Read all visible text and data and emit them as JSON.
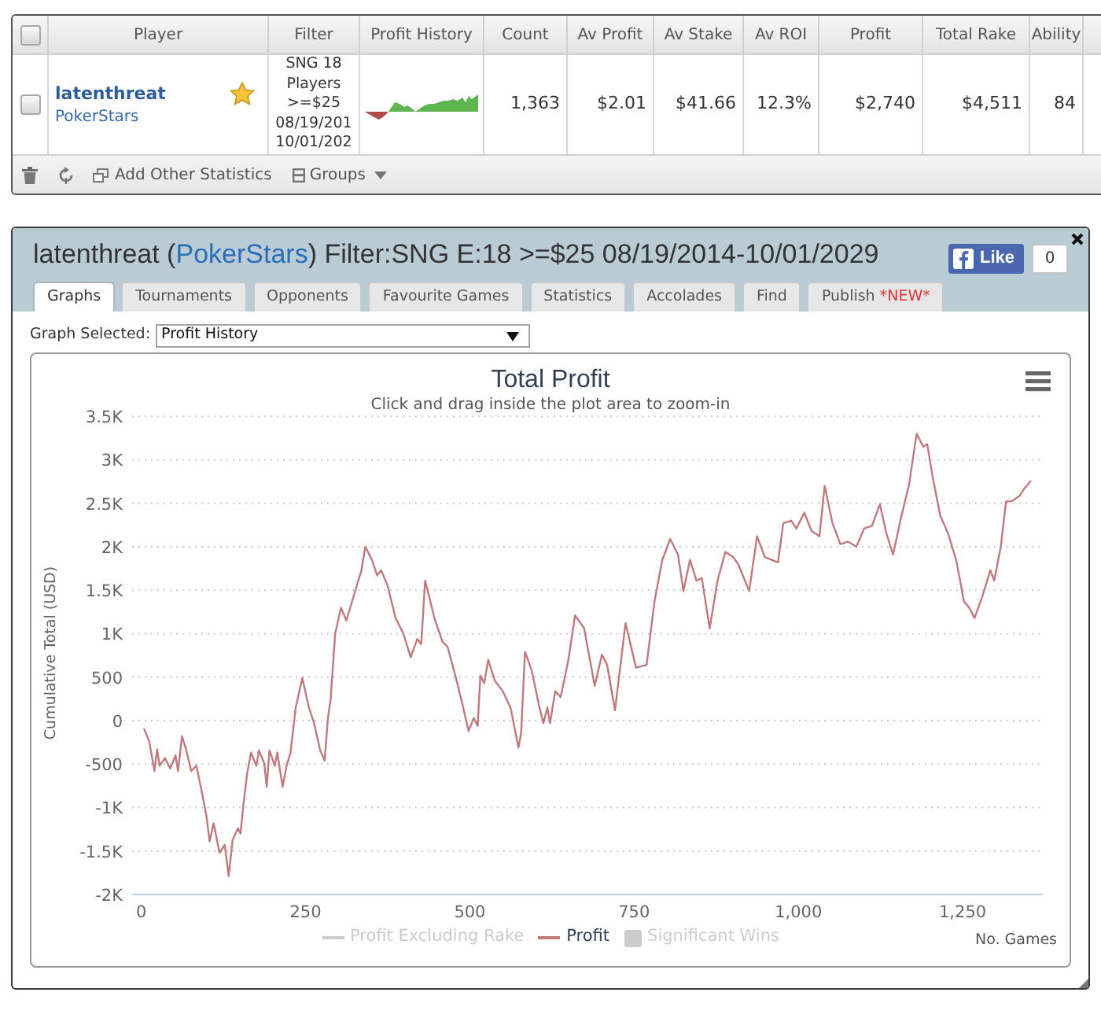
{
  "stats_table": {
    "select_all": {
      "checked": false
    },
    "columns": [
      "Player",
      "Filter",
      "Profit History",
      "Count",
      "Av Profit",
      "Av Stake",
      "Av ROI",
      "Profit",
      "Total Rake",
      "Ability"
    ],
    "rows": [
      {
        "checked": false,
        "player": "latenthreat",
        "site": "PokerStars",
        "favourite": true,
        "filter": [
          "SNG 18",
          "Players",
          ">=$25",
          "08/19/201",
          "10/01/202"
        ],
        "count": "1,363",
        "av_profit": "$2.01",
        "av_stake": "$41.66",
        "av_roi": "12.3%",
        "profit": "$2,740",
        "total_rake": "$4,511",
        "ability": "84"
      }
    ],
    "toolbar": [
      {
        "kind": "delete"
      },
      {
        "kind": "refresh"
      },
      {
        "kind": "add",
        "label": "Add Other Statistics"
      },
      {
        "kind": "groups",
        "label": "Groups"
      }
    ]
  },
  "profile_panel": {
    "title": [
      {
        "kind": "plain",
        "text": "latenthreat ("
      },
      {
        "kind": "link",
        "text": "PokerStars"
      },
      {
        "kind": "plain",
        "text": ") Filter:SNG E:18 >=$25 08/19/2014-10/01/2029"
      }
    ],
    "like_button": {
      "label": "Like",
      "count": "0"
    },
    "tabs": [
      {
        "label": "Graphs",
        "selected": true
      },
      {
        "label": "Tournaments",
        "selected": false
      },
      {
        "label": "Opponents",
        "selected": false
      },
      {
        "label": "Favourite Games",
        "selected": false
      },
      {
        "label": "Statistics",
        "selected": false
      },
      {
        "label": "Accolades",
        "selected": false
      },
      {
        "label": "Find",
        "selected": false
      },
      {
        "label": "Publish",
        "badge": "*NEW*",
        "selected": false
      }
    ],
    "graph_selector": {
      "label": "Graph Selected:",
      "value": "Profit History"
    },
    "chart": {
      "subtitle": "Click and drag inside the plot area to zoom-in",
      "chart_data": {
        "type": "line",
        "title": "Total Profit",
        "xlabel": "No. Games",
        "ylabel": "Cumulative Total (USD)",
        "grid": true,
        "x": [
          4,
          12,
          20,
          24,
          28,
          36,
          44,
          52,
          56,
          62,
          68,
          76,
          84,
          92,
          99,
          104,
          110,
          119,
          127,
          133,
          139,
          147,
          151,
          155,
          161,
          167,
          175,
          179,
          187,
          191,
          195,
          203,
          207,
          215,
          221,
          227,
          235,
          245,
          255,
          263,
          272,
          279,
          284,
          288,
          295,
          304,
          312,
          323,
          335,
          341,
          351,
          359,
          365,
          375,
          387,
          399,
          410,
          420,
          426,
          432,
          446,
          458,
          466,
          478,
          490,
          498,
          506,
          512,
          516,
          522,
          528,
          538,
          550,
          562,
          574,
          578,
          584,
          594,
          606,
          612,
          618,
          622,
          630,
          638,
          650,
          660,
          674,
          690,
          701,
          709,
          721,
          737,
          753,
          769,
          781,
          793,
          805,
          817,
          825,
          835,
          845,
          853,
          865,
          877,
          889,
          901,
          909,
          925,
          937,
          949,
          969,
          977,
          989,
          997,
          1009,
          1020,
          1032,
          1040,
          1052,
          1064,
          1076,
          1088,
          1100,
          1112,
          1124,
          1134,
          1144,
          1156,
          1168,
          1180,
          1190,
          1196,
          1204,
          1216,
          1228,
          1240,
          1252,
          1260,
          1268,
          1280,
          1292,
          1298,
          1308,
          1316,
          1324,
          1336,
          1344,
          1354
        ],
        "series": [
          {
            "name": "Profit",
            "color": "#bf7a7e",
            "values": [
              -90,
              -240,
              -580,
              -330,
              -520,
              -430,
              -550,
              -400,
              -580,
              -180,
              -330,
              -580,
              -520,
              -820,
              -1090,
              -1390,
              -1180,
              -1520,
              -1430,
              -1790,
              -1370,
              -1240,
              -1300,
              -1000,
              -610,
              -370,
              -520,
              -340,
              -490,
              -760,
              -340,
              -520,
              -370,
              -760,
              -520,
              -370,
              150,
              490,
              150,
              -30,
              -340,
              -460,
              30,
              240,
              1000,
              1300,
              1150,
              1430,
              1730,
              2000,
              1850,
              1670,
              1730,
              1550,
              1180,
              1000,
              730,
              940,
              880,
              1610,
              1180,
              910,
              850,
              520,
              150,
              -120,
              30,
              -60,
              520,
              430,
              700,
              460,
              340,
              150,
              -310,
              -150,
              790,
              580,
              150,
              -30,
              150,
              -30,
              340,
              270,
              700,
              1210,
              1060,
              400,
              760,
              640,
              120,
              1120,
              610,
              640,
              1370,
              1850,
              2090,
              1910,
              1490,
              1850,
              1610,
              1640,
              1060,
              1610,
              1940,
              1880,
              1790,
              1490,
              2120,
              1880,
              1820,
              2270,
              2300,
              2210,
              2390,
              2180,
              2120,
              2700,
              2270,
              2030,
              2060,
              2000,
              2210,
              2240,
              2490,
              2150,
              1910,
              2330,
              2700,
              3300,
              3150,
              3180,
              2820,
              2360,
              2150,
              1850,
              1370,
              1300,
              1180,
              1430,
              1730,
              1610,
              2000,
              2520,
              2520,
              2580,
              2670,
              2760
            ]
          }
        ],
        "xlim": [
          -14,
          1372
        ],
        "ylim": [
          -2000,
          3500
        ],
        "xticks": [
          {
            "value": 0,
            "label": "0"
          },
          {
            "value": 250,
            "label": "250"
          },
          {
            "value": 500,
            "label": "500"
          },
          {
            "value": 750,
            "label": "750"
          },
          {
            "value": 1000,
            "label": "1,000"
          },
          {
            "value": 1250,
            "label": "1,250"
          }
        ],
        "yticks": [
          {
            "value": -2000,
            "label": "-2K"
          },
          {
            "value": -1500,
            "label": "-1.5K"
          },
          {
            "value": -1000,
            "label": "-1K"
          },
          {
            "value": -500,
            "label": "-500"
          },
          {
            "value": 0,
            "label": "0"
          },
          {
            "value": 500,
            "label": "500"
          },
          {
            "value": 1000,
            "label": "1K"
          },
          {
            "value": 1500,
            "label": "1.5K"
          },
          {
            "value": 2000,
            "label": "2K"
          },
          {
            "value": 2500,
            "label": "2.5K"
          },
          {
            "value": 3000,
            "label": "3K"
          },
          {
            "value": 3500,
            "label": "3.5K"
          }
        ]
      },
      "legend": [
        {
          "kind": "line",
          "label": "Profit Excluding Rake",
          "visible": false
        },
        {
          "kind": "series",
          "visible": true
        },
        {
          "kind": "area",
          "label": "Significant Wins",
          "visible": false
        }
      ]
    }
  }
}
